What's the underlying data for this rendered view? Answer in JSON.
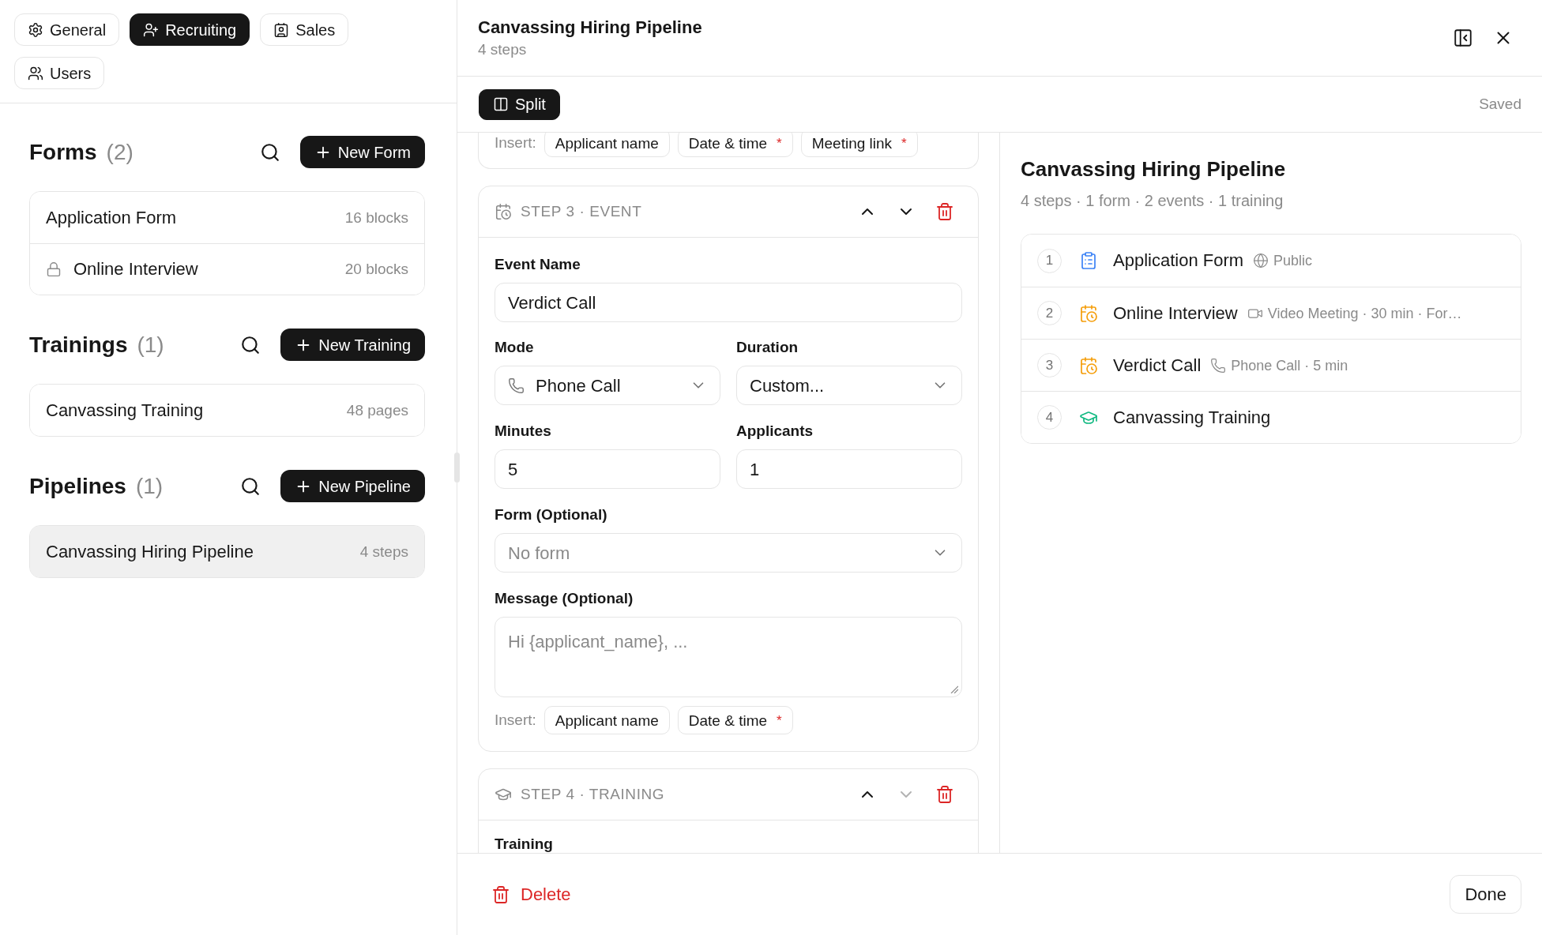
{
  "sidebar": {
    "tabs": [
      {
        "label": "General",
        "selected": false
      },
      {
        "label": "Recruiting",
        "selected": true
      },
      {
        "label": "Sales",
        "selected": false
      },
      {
        "label": "Users",
        "selected": false
      }
    ],
    "sections": [
      {
        "title": "Forms",
        "count": "(2)",
        "new_button": "New Form",
        "items": [
          {
            "name": "Application Form",
            "meta": "16 blocks",
            "locked": false,
            "selected": false
          },
          {
            "name": "Online Interview",
            "meta": "20 blocks",
            "locked": true,
            "selected": false
          }
        ]
      },
      {
        "title": "Trainings",
        "count": "(1)",
        "new_button": "New Training",
        "items": [
          {
            "name": "Canvassing Training",
            "meta": "48 pages",
            "locked": false,
            "selected": false
          }
        ]
      },
      {
        "title": "Pipelines",
        "count": "(1)",
        "new_button": "New Pipeline",
        "items": [
          {
            "name": "Canvassing Hiring Pipeline",
            "meta": "4 steps",
            "locked": false,
            "selected": true
          }
        ]
      }
    ]
  },
  "editor": {
    "header": {
      "title": "Canvassing Hiring Pipeline",
      "subtitle": "4 steps"
    },
    "toolbar": {
      "split_button": {
        "label": "Split",
        "on": true
      },
      "status": "Saved"
    },
    "partial_step": {
      "insert_label": "Insert:",
      "chips": [
        {
          "label": "Applicant name"
        },
        {
          "label": "Date & time",
          "mark": "*"
        },
        {
          "label": "Meeting link",
          "mark": "*"
        }
      ]
    },
    "steps": [
      {
        "kind": "event",
        "heading": "STEP 3 · EVENT",
        "up_disabled": false,
        "down_disabled": false,
        "fields": {
          "event_name": {
            "label": "Event Name",
            "value": "Verdict Call"
          },
          "mode": {
            "label": "Mode",
            "value": "Phone Call"
          },
          "duration": {
            "label": "Duration",
            "value": "Custom..."
          },
          "minutes": {
            "label": "Minutes",
            "value": "5"
          },
          "applicants": {
            "label": "Applicants",
            "value": "1"
          },
          "form": {
            "label": "Form (Optional)",
            "placeholder": "No form"
          },
          "message": {
            "label": "Message (Optional)",
            "placeholder": "Hi {applicant_name}, ..."
          },
          "insert": {
            "label": "Insert:",
            "chips": [
              {
                "label": "Applicant name"
              },
              {
                "label": "Date & time",
                "mark": "*"
              }
            ]
          }
        }
      },
      {
        "kind": "training",
        "heading": "STEP 4 · TRAINING",
        "up_disabled": false,
        "down_disabled": true,
        "fields": {
          "training": {
            "label": "Training"
          }
        }
      }
    ]
  },
  "preview": {
    "title": "Canvassing Hiring Pipeline",
    "summary": "4 steps · 1 form · 2 events · 1 training",
    "steps": [
      {
        "number": "1",
        "kind": "form",
        "name": "Application Form",
        "detail": {
          "kind": "visibility",
          "text": "Public"
        }
      },
      {
        "number": "2",
        "kind": "event",
        "name": "Online Interview",
        "detail": {
          "kind": "video",
          "text": "Video Meeting · 30 min · For…"
        }
      },
      {
        "number": "3",
        "kind": "event",
        "name": "Verdict Call",
        "detail": {
          "kind": "phone",
          "text": "Phone Call · 5 min"
        }
      },
      {
        "number": "4",
        "kind": "training",
        "name": "Canvassing Training"
      }
    ]
  },
  "footer": {
    "delete_button": "Delete",
    "done_button": "Done"
  }
}
